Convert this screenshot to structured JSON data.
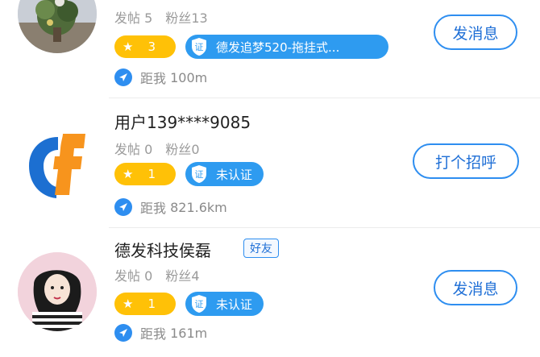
{
  "users": [
    {
      "name": "",
      "posts_label": "发帖",
      "posts": "5",
      "fans_label": "粉丝",
      "fans": "13",
      "level": "3",
      "cert_label": "德发追梦520-拖挂式...",
      "distance_prefix": "距我",
      "distance": "100m",
      "action_label": "发消息",
      "avatar": "plant-photo"
    },
    {
      "name": "用户139****9085",
      "posts_label": "发帖",
      "posts": "0",
      "fans_label": "粉丝",
      "fans": "0",
      "level": "1",
      "cert_label": "未认证",
      "distance_prefix": "距我",
      "distance": "821.6km",
      "action_label": "打个招呼",
      "avatar": "f-logo"
    },
    {
      "name": "德发科技侯磊",
      "tag": "好友",
      "posts_label": "发帖",
      "posts": "0",
      "fans_label": "粉丝",
      "fans": "4",
      "level": "1",
      "cert_label": "未认证",
      "distance_prefix": "距我",
      "distance": "161m",
      "action_label": "发消息",
      "avatar": "woman-illustration"
    }
  ],
  "colors": {
    "accent": "#2e8ef0",
    "level_badge": "#ffc107",
    "cert_badge": "#2e9bf0"
  },
  "icons": [
    "star-icon",
    "shield-cert-icon",
    "location-arrow-icon"
  ]
}
